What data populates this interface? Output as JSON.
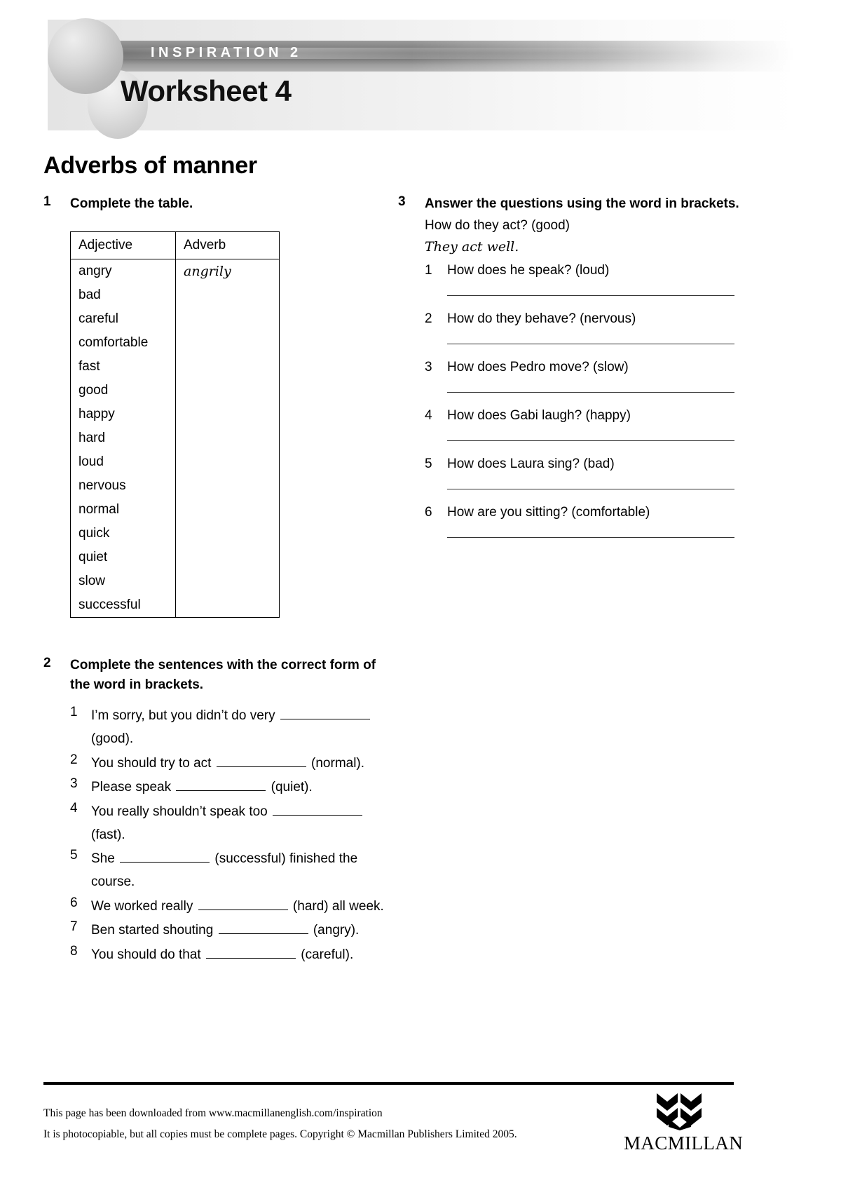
{
  "header": {
    "series_label": "INSPIRATION 2",
    "worksheet_title": "Worksheet 4"
  },
  "page_title": "Adverbs of manner",
  "exercise1": {
    "number": "1",
    "instruction": "Complete the table.",
    "table": {
      "columns": [
        "Adjective",
        "Adverb"
      ],
      "rows": [
        {
          "adjective": "angry",
          "adverb": "angrily"
        },
        {
          "adjective": "bad",
          "adverb": ""
        },
        {
          "adjective": "careful",
          "adverb": ""
        },
        {
          "adjective": "comfortable",
          "adverb": ""
        },
        {
          "adjective": "fast",
          "adverb": ""
        },
        {
          "adjective": "good",
          "adverb": ""
        },
        {
          "adjective": "happy",
          "adverb": ""
        },
        {
          "adjective": "hard",
          "adverb": ""
        },
        {
          "adjective": "loud",
          "adverb": ""
        },
        {
          "adjective": "nervous",
          "adverb": ""
        },
        {
          "adjective": "normal",
          "adverb": ""
        },
        {
          "adjective": "quick",
          "adverb": ""
        },
        {
          "adjective": "quiet",
          "adverb": ""
        },
        {
          "adjective": "slow",
          "adverb": ""
        },
        {
          "adjective": "successful",
          "adverb": ""
        }
      ]
    }
  },
  "exercise2": {
    "number": "2",
    "instruction": "Complete the sentences with the correct form of the word in brackets.",
    "items": [
      {
        "num": "1",
        "before": "I’m sorry, but you didn’t do very ",
        "after": " (good)."
      },
      {
        "num": "2",
        "before": "You should try to act ",
        "after": " (normal)."
      },
      {
        "num": "3",
        "before": "Please speak ",
        "after": " (quiet)."
      },
      {
        "num": "4",
        "before": "You really shouldn’t speak too ",
        "after": " (fast)."
      },
      {
        "num": "5",
        "before": "She ",
        "after": " (successful) finished the course."
      },
      {
        "num": "6",
        "before": "We worked really ",
        "after": " (hard) all week."
      },
      {
        "num": "7",
        "before": "Ben started shouting ",
        "after": " (angry)."
      },
      {
        "num": "8",
        "before": "You should do that ",
        "after": " (careful)."
      }
    ]
  },
  "exercise3": {
    "number": "3",
    "instruction": "Answer the questions using the word in brackets.",
    "example_question": "How do they act? (good)",
    "example_answer": "They act well.",
    "items": [
      {
        "num": "1",
        "text": "How does he speak? (loud)"
      },
      {
        "num": "2",
        "text": "How do they behave? (nervous)"
      },
      {
        "num": "3",
        "text": "How does Pedro move? (slow)"
      },
      {
        "num": "4",
        "text": "How does Gabi laugh? (happy)"
      },
      {
        "num": "5",
        "text": "How does Laura sing? (bad)"
      },
      {
        "num": "6",
        "text": "How are you sitting? (comfortable)"
      }
    ]
  },
  "footer": {
    "line1": "This page has been downloaded from www.macmillanenglish.com/inspiration",
    "line2": "It is photocopiable, but all copies must be complete pages. Copyright © Macmillan Publishers Limited 2005.",
    "logo_word": "MACMILLAN"
  }
}
